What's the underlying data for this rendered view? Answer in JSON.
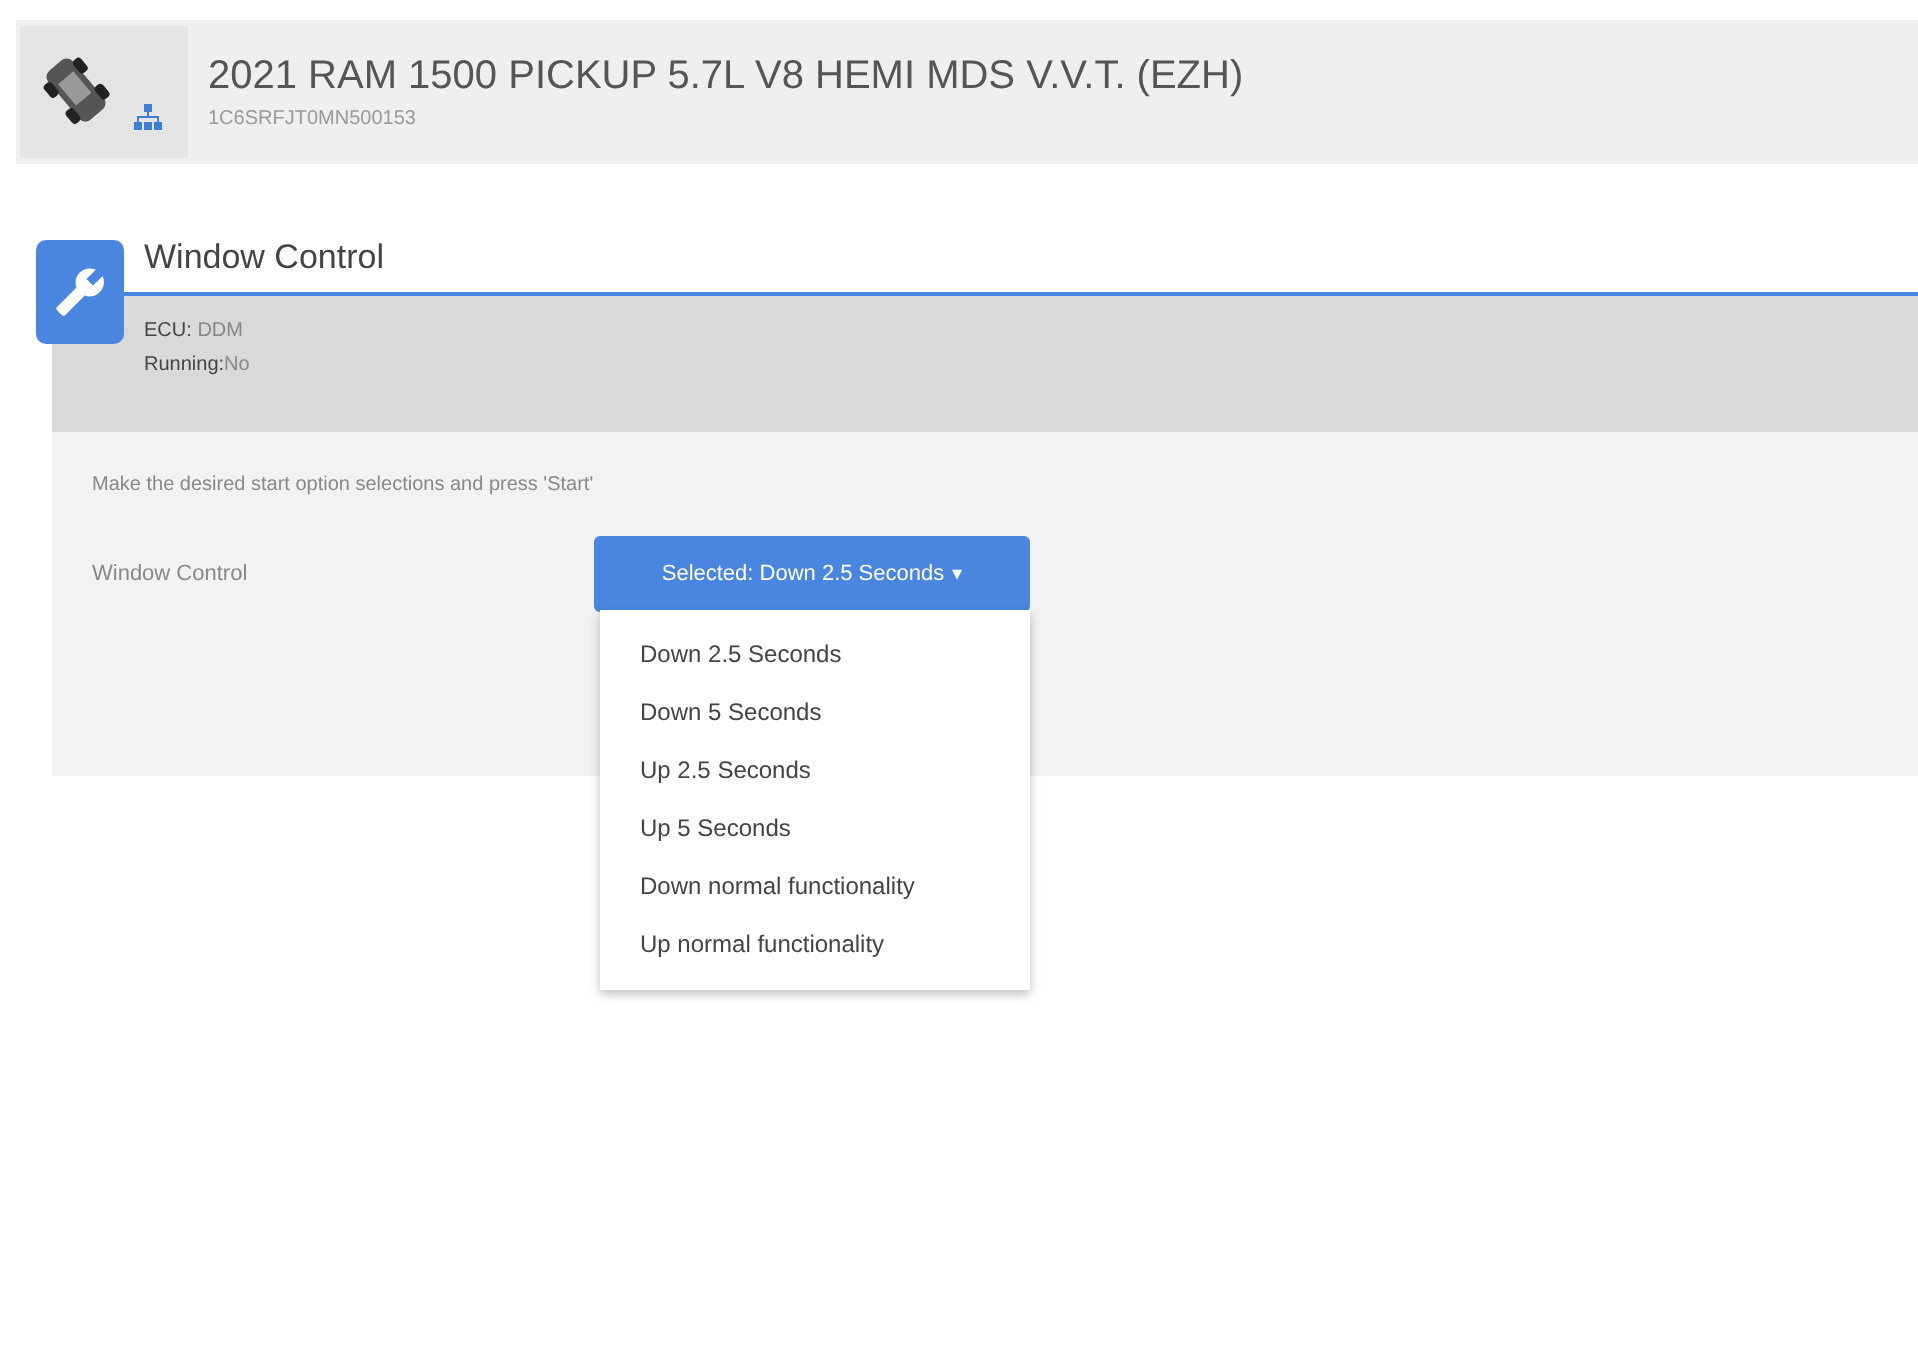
{
  "vehicle": {
    "title": "2021 RAM 1500 PICKUP 5.7L V8 HEMI MDS V.V.T. (EZH)",
    "vin": "1C6SRFJT0MN500153"
  },
  "panel": {
    "title": "Window Control",
    "ecu_label": "ECU:",
    "ecu_value": "DDM",
    "running_label": "Running:",
    "running_value": "No",
    "instruction": "Make the desired start option selections and press 'Start'",
    "option": {
      "label": "Window Control",
      "button": "Selected: Down 2.5 Seconds",
      "caret": "▾",
      "expanded": true,
      "items": [
        "Down 2.5 Seconds",
        "Down 5 Seconds",
        "Up 2.5 Seconds",
        "Up 5 Seconds",
        "Down normal functionality",
        "Up normal functionality"
      ]
    }
  }
}
